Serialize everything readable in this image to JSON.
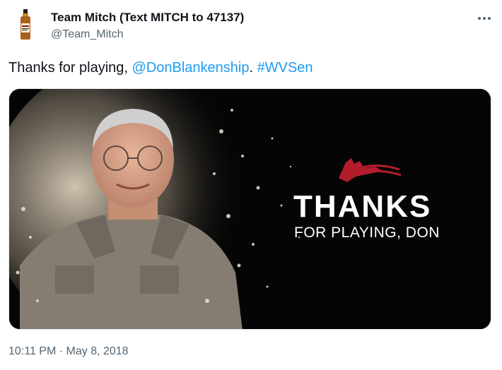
{
  "tweet": {
    "display_name": "Team Mitch (Text MITCH to 47137)",
    "handle": "@Team_Mitch",
    "text_prefix": "Thanks for playing, ",
    "mention": "@DonBlankenship",
    "text_separator": ". ",
    "hashtag": "#WVSen",
    "timestamp": "10:11 PM · May 8, 2018"
  },
  "media": {
    "headline": "THANKS",
    "subline": "FOR PLAYING, DON"
  },
  "colors": {
    "link": "#1d9bf0",
    "secondary_text": "#536471",
    "logo_red": "#b31d2b",
    "media_background": "#050505"
  },
  "icons": {
    "more": "more-horizontal-icon",
    "avatar": "bourbon-bottle-avatar"
  }
}
